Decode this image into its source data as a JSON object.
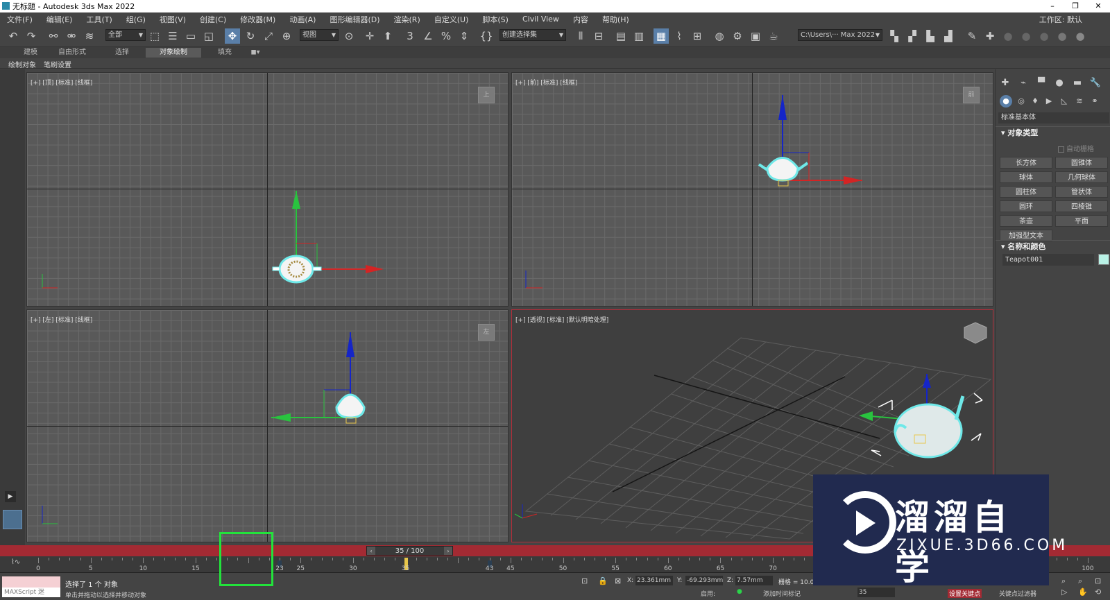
{
  "title": "无标题 - Autodesk 3ds Max 2022",
  "menu": [
    "文件(F)",
    "编辑(E)",
    "工具(T)",
    "组(G)",
    "视图(V)",
    "创建(C)",
    "修改器(M)",
    "动画(A)",
    "图形编辑器(D)",
    "渲染(R)",
    "自定义(U)",
    "脚本(S)",
    "Civil View",
    "内容",
    "帮助(H)"
  ],
  "workspace": "工作区: 默认",
  "toolbar": {
    "selection_filter": "全部",
    "ref_coord": "视图",
    "named_sel": "创建选择集",
    "project_path": "C:\\Users\\··· Max 2022"
  },
  "ribbon_tabs": [
    "建模",
    "自由形式",
    "选择",
    "对象绘制",
    "填充"
  ],
  "ribbon_active": "对象绘制",
  "ribbon_sub": [
    "绘制对象",
    "笔刷设置"
  ],
  "viewports": {
    "top": {
      "label": "[+] [顶] [标准] [线框]",
      "cube": "上"
    },
    "front": {
      "label": "[+] [前] [标准] [线框]",
      "cube": "前"
    },
    "left": {
      "label": "[+] [左] [标准] [线框]",
      "cube": "左"
    },
    "persp": {
      "label": "[+] [透视] [标准] [默认明暗处理]"
    }
  },
  "command_panel": {
    "category": "标准基本体",
    "object_type_title": "对象类型",
    "autogrid": "自动栅格",
    "buttons": [
      "长方体",
      "圆锥体",
      "球体",
      "几何球体",
      "圆柱体",
      "管状体",
      "圆环",
      "四棱锥",
      "茶壶",
      "平面",
      "加强型文本"
    ],
    "name_color_title": "名称和颜色",
    "object_name": "Teapot001",
    "object_color": "#b9f2e6"
  },
  "time_slider": {
    "current": 35,
    "total": 100,
    "label": "35 / 100"
  },
  "track": {
    "ticks": [
      "0",
      "5",
      "10",
      "15",
      "23",
      "25",
      "30",
      "35",
      "43",
      "45",
      "50",
      "55",
      "60",
      "65",
      "70",
      "100"
    ],
    "current_frame": 35,
    "key_frames": [
      23,
      43
    ]
  },
  "status": {
    "maxscript": "MAXScript 迷",
    "selection": "选择了 1 个 对象",
    "hint": "单击并拖动以选择并移动对象",
    "x_label": "X:",
    "x": "23.361mm",
    "y_label": "Y:",
    "y": "-69.293mm",
    "z_label": "Z:",
    "z": "7.57mm",
    "grid": "栅格 = 10.0mm",
    "enable": "启用:",
    "add_tag": "添加时间标记",
    "set_key": "设置关键点",
    "key_filter": "关键点过滤器",
    "frame": "35"
  },
  "watermark": {
    "cn": "溜溜自学",
    "en": "ZIXUE.3D66.COM"
  }
}
